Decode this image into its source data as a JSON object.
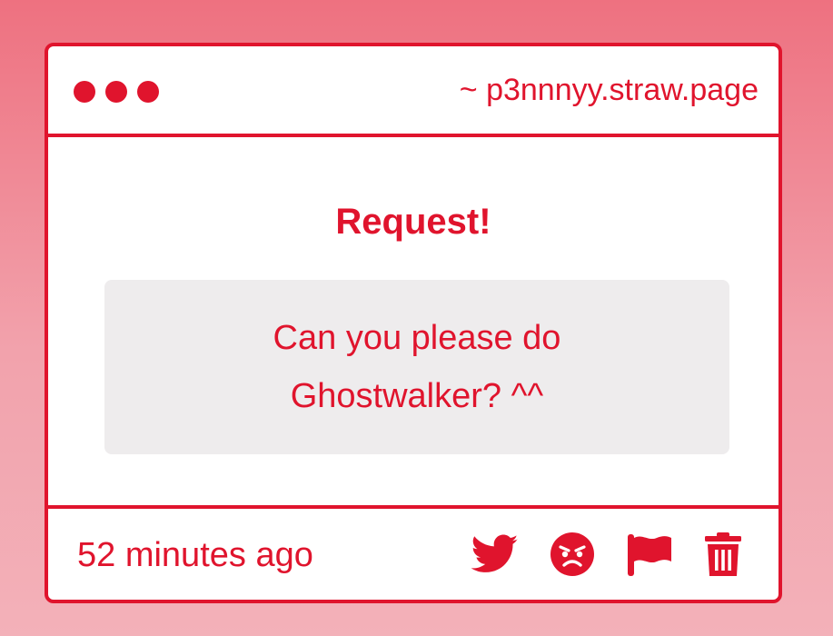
{
  "window": {
    "url_text": "~ p3nnnyy.straw.page"
  },
  "content": {
    "heading": "Request!",
    "message": "Can you please do Ghostwalker? ^^"
  },
  "footer": {
    "timestamp": "52 minutes ago",
    "actions": [
      {
        "icon": "twitter-icon"
      },
      {
        "icon": "angry-face-icon"
      },
      {
        "icon": "flag-icon"
      },
      {
        "icon": "trash-icon"
      }
    ]
  },
  "colors": {
    "accent": "#e0142d",
    "message_bg": "#eeeced",
    "background_top": "#ee7180",
    "background_bottom": "#f3b1b9"
  }
}
